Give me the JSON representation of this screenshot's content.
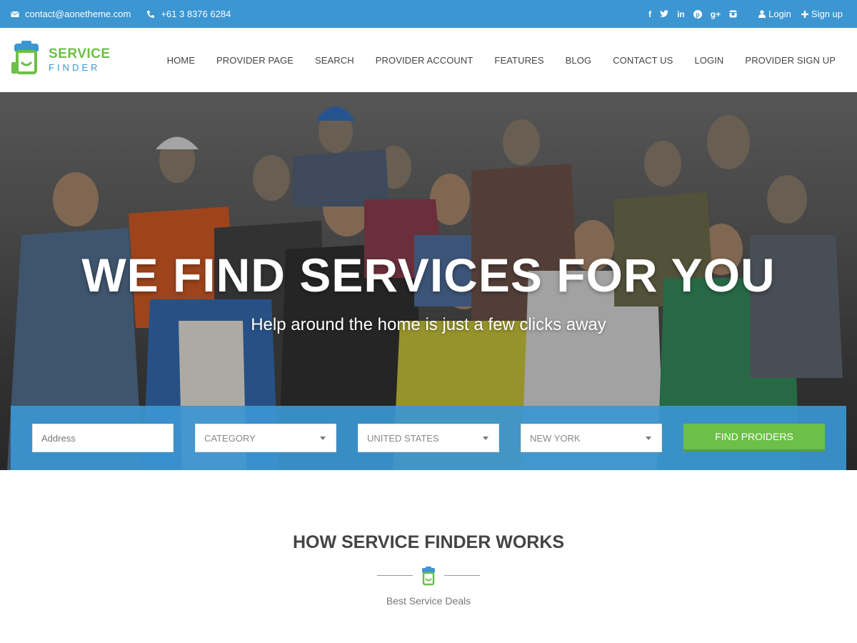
{
  "topbar": {
    "email": "contact@aonetheme.com",
    "phone": "+61 3 8376 6284",
    "social_icons": [
      "facebook-icon",
      "twitter-icon",
      "linkedin-icon",
      "pinterest-icon",
      "google-plus-icon",
      "instagram-icon"
    ],
    "login_label": "Login",
    "signup_label": "Sign up"
  },
  "logo": {
    "line1": "SERVICE",
    "line2": "FINDER"
  },
  "nav": {
    "items": [
      "HOME",
      "PROVIDER PAGE",
      "SEARCH",
      "PROVIDER ACCOUNT",
      "FEATURES",
      "BLOG",
      "CONTACT US",
      "LOGIN",
      "PROVIDER SIGN UP"
    ]
  },
  "hero": {
    "title": "WE FIND SERVICES FOR YOU",
    "subtitle": "Help around the home is just a few clicks away"
  },
  "search": {
    "address_placeholder": "Address",
    "category_value": "CATEGORY",
    "country_value": "UNITED STATES",
    "city_value": "NEW YORK",
    "button_label": "FIND PROIDERS"
  },
  "how": {
    "title": "HOW SERVICE FINDER WORKS",
    "tagline": "Best Service Deals"
  },
  "colors": {
    "primary_blue": "#3b96d2",
    "accent_green": "#6cbf47"
  }
}
